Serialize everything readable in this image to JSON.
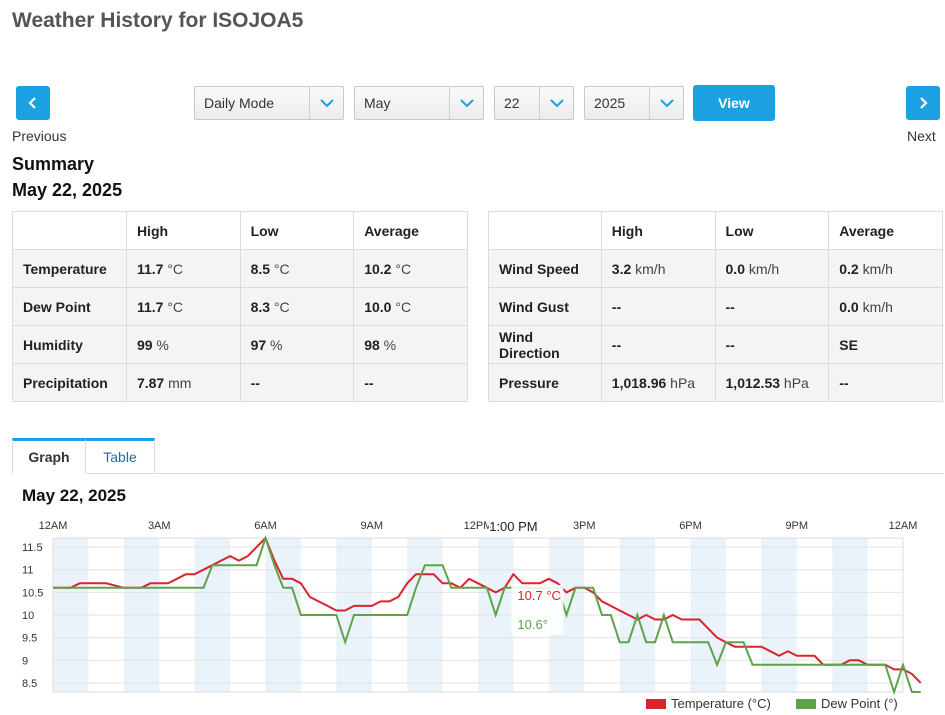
{
  "page": {
    "title": "Weather History for ISOJOA5"
  },
  "nav": {
    "previous_label": "Previous",
    "next_label": "Next",
    "mode": "Daily Mode",
    "month": "May",
    "day": "22",
    "year": "2025",
    "view_label": "View"
  },
  "summary": {
    "title": "Summary",
    "date": "May 22, 2025",
    "headers": [
      "",
      "High",
      "Low",
      "Average"
    ],
    "left_rows": [
      {
        "label": "Temperature",
        "high": "11.7",
        "high_unit": "°C",
        "low": "8.5",
        "low_unit": "°C",
        "avg": "10.2",
        "avg_unit": "°C"
      },
      {
        "label": "Dew Point",
        "high": "11.7",
        "high_unit": "°C",
        "low": "8.3",
        "low_unit": "°C",
        "avg": "10.0",
        "avg_unit": "°C"
      },
      {
        "label": "Humidity",
        "high": "99",
        "high_unit": "%",
        "low": "97",
        "low_unit": "%",
        "avg": "98",
        "avg_unit": "%"
      },
      {
        "label": "Precipitation",
        "high": "7.87",
        "high_unit": "mm",
        "low": "--",
        "low_unit": "",
        "avg": "--",
        "avg_unit": ""
      }
    ],
    "right_rows": [
      {
        "label": "Wind Speed",
        "high": "3.2",
        "high_unit": "km/h",
        "low": "0.0",
        "low_unit": "km/h",
        "avg": "0.2",
        "avg_unit": "km/h"
      },
      {
        "label": "Wind Gust",
        "high": "--",
        "high_unit": "",
        "low": "--",
        "low_unit": "",
        "avg": "0.0",
        "avg_unit": "km/h"
      },
      {
        "label": "Wind Direction",
        "high": "--",
        "high_unit": "",
        "low": "--",
        "low_unit": "",
        "avg": "SE",
        "avg_unit": ""
      },
      {
        "label": "Pressure",
        "high": "1,018.96",
        "high_unit": "hPa",
        "low": "1,012.53",
        "low_unit": "hPa",
        "avg": "--",
        "avg_unit": ""
      }
    ]
  },
  "tabs": [
    {
      "label": "Graph",
      "active": true
    },
    {
      "label": "Table",
      "active": false
    }
  ],
  "graph": {
    "date": "May 22, 2025"
  },
  "colors": {
    "accent": "#1ba1e2",
    "temperature": "#d9232d",
    "dew_point": "#5ea34a"
  },
  "chart_data": {
    "type": "line",
    "x_tick_labels": [
      "12AM",
      "3AM",
      "6AM",
      "9AM",
      "12PM",
      "3PM",
      "6PM",
      "9PM",
      "12AM"
    ],
    "y_tick_labels": [
      "11.5",
      "11",
      "10.5",
      "10",
      "9.5",
      "9",
      "8.5"
    ],
    "y_ticks": [
      11.5,
      11,
      10.5,
      10,
      9.5,
      9,
      8.5
    ],
    "xlim": [
      0,
      24
    ],
    "ylim": [
      8.3,
      11.7
    ],
    "tooltip": {
      "time": "1:00 PM",
      "temperature": "10.7 °C",
      "dew_point": "10.6°"
    },
    "series": [
      {
        "name": "Temperature (°C)",
        "color": "#d9232d",
        "points": [
          [
            0,
            10.6
          ],
          [
            0.5,
            10.6
          ],
          [
            0.75,
            10.7
          ],
          [
            1,
            10.7
          ],
          [
            1.5,
            10.7
          ],
          [
            2,
            10.6
          ],
          [
            2.5,
            10.6
          ],
          [
            2.75,
            10.7
          ],
          [
            3.25,
            10.7
          ],
          [
            3.5,
            10.8
          ],
          [
            3.75,
            10.9
          ],
          [
            4,
            10.9
          ],
          [
            4.25,
            11
          ],
          [
            4.5,
            11.1
          ],
          [
            4.75,
            11.2
          ],
          [
            5,
            11.3
          ],
          [
            5.25,
            11.2
          ],
          [
            5.5,
            11.3
          ],
          [
            5.75,
            11.5
          ],
          [
            6,
            11.7
          ],
          [
            6.25,
            11.2
          ],
          [
            6.5,
            10.8
          ],
          [
            6.75,
            10.8
          ],
          [
            7,
            10.7
          ],
          [
            7.25,
            10.4
          ],
          [
            7.5,
            10.3
          ],
          [
            7.75,
            10.2
          ],
          [
            8,
            10.1
          ],
          [
            8.25,
            10.1
          ],
          [
            8.5,
            10.2
          ],
          [
            8.75,
            10.2
          ],
          [
            9,
            10.2
          ],
          [
            9.25,
            10.3
          ],
          [
            9.5,
            10.3
          ],
          [
            9.75,
            10.4
          ],
          [
            10,
            10.7
          ],
          [
            10.25,
            10.9
          ],
          [
            10.5,
            10.9
          ],
          [
            10.75,
            10.9
          ],
          [
            11,
            10.7
          ],
          [
            11.25,
            10.7
          ],
          [
            11.5,
            10.6
          ],
          [
            11.75,
            10.8
          ],
          [
            12,
            10.7
          ],
          [
            12.25,
            10.6
          ],
          [
            12.5,
            10.5
          ],
          [
            12.75,
            10.6
          ],
          [
            13,
            10.9
          ],
          [
            13.25,
            10.7
          ],
          [
            13.5,
            10.7
          ],
          [
            13.75,
            10.7
          ],
          [
            14,
            10.8
          ],
          [
            14.25,
            10.7
          ],
          [
            14.5,
            10.5
          ],
          [
            14.75,
            10.6
          ],
          [
            15,
            10.6
          ],
          [
            15.25,
            10.5
          ],
          [
            15.5,
            10.3
          ],
          [
            15.75,
            10.2
          ],
          [
            16,
            10.1
          ],
          [
            16.25,
            10
          ],
          [
            16.5,
            9.9
          ],
          [
            16.75,
            10
          ],
          [
            17,
            9.9
          ],
          [
            17.25,
            9.9
          ],
          [
            17.5,
            10
          ],
          [
            17.75,
            9.9
          ],
          [
            18,
            9.9
          ],
          [
            18.25,
            9.9
          ],
          [
            18.5,
            9.7
          ],
          [
            18.75,
            9.5
          ],
          [
            19,
            9.4
          ],
          [
            19.25,
            9.3
          ],
          [
            19.5,
            9.3
          ],
          [
            19.75,
            9.3
          ],
          [
            20,
            9.3
          ],
          [
            20.25,
            9.2
          ],
          [
            20.5,
            9.1
          ],
          [
            20.75,
            9.2
          ],
          [
            21,
            9.1
          ],
          [
            21.5,
            9.1
          ],
          [
            21.75,
            8.9
          ],
          [
            22,
            8.9
          ],
          [
            22.25,
            8.9
          ],
          [
            22.5,
            9
          ],
          [
            22.75,
            9
          ],
          [
            23,
            8.9
          ],
          [
            23.5,
            8.9
          ],
          [
            23.75,
            8.8
          ],
          [
            24,
            8.8
          ],
          [
            24.25,
            8.7
          ],
          [
            24.5,
            8.5
          ]
        ]
      },
      {
        "name": "Dew Point (°)",
        "color": "#5ea34a",
        "points": [
          [
            0,
            10.6
          ],
          [
            1,
            10.6
          ],
          [
            2,
            10.6
          ],
          [
            3,
            10.6
          ],
          [
            4,
            10.6
          ],
          [
            4.25,
            10.6
          ],
          [
            4.5,
            11.1
          ],
          [
            5,
            11.1
          ],
          [
            5.5,
            11.1
          ],
          [
            5.75,
            11.1
          ],
          [
            6,
            11.7
          ],
          [
            6.25,
            11.1
          ],
          [
            6.5,
            10.6
          ],
          [
            6.75,
            10.6
          ],
          [
            7,
            10
          ],
          [
            7.5,
            10
          ],
          [
            8,
            10
          ],
          [
            8.25,
            9.4
          ],
          [
            8.5,
            10
          ],
          [
            9,
            10
          ],
          [
            9.5,
            10
          ],
          [
            10,
            10
          ],
          [
            10.25,
            10.6
          ],
          [
            10.5,
            11.1
          ],
          [
            11,
            11.1
          ],
          [
            11.25,
            10.6
          ],
          [
            12,
            10.6
          ],
          [
            12.25,
            10.6
          ],
          [
            12.5,
            10
          ],
          [
            12.75,
            10.6
          ],
          [
            13,
            10.6
          ],
          [
            13.25,
            10.6
          ],
          [
            14,
            10.6
          ],
          [
            14.25,
            10.6
          ],
          [
            14.5,
            10
          ],
          [
            14.75,
            10.6
          ],
          [
            15,
            10.6
          ],
          [
            15.25,
            10.6
          ],
          [
            15.5,
            10
          ],
          [
            15.75,
            10
          ],
          [
            16,
            9.4
          ],
          [
            16.25,
            9.4
          ],
          [
            16.5,
            10
          ],
          [
            16.75,
            9.4
          ],
          [
            17,
            9.4
          ],
          [
            17.25,
            10
          ],
          [
            17.5,
            9.4
          ],
          [
            18,
            9.4
          ],
          [
            18.5,
            9.4
          ],
          [
            18.75,
            8.9
          ],
          [
            19,
            9.4
          ],
          [
            19.5,
            9.4
          ],
          [
            19.75,
            8.9
          ],
          [
            20,
            8.9
          ],
          [
            21,
            8.9
          ],
          [
            22,
            8.9
          ],
          [
            23,
            8.9
          ],
          [
            23.5,
            8.9
          ],
          [
            23.75,
            8.3
          ],
          [
            24,
            8.9
          ],
          [
            24.25,
            8.3
          ],
          [
            24.5,
            8.3
          ]
        ]
      }
    ],
    "grid": true,
    "legend": "bottom-right"
  }
}
